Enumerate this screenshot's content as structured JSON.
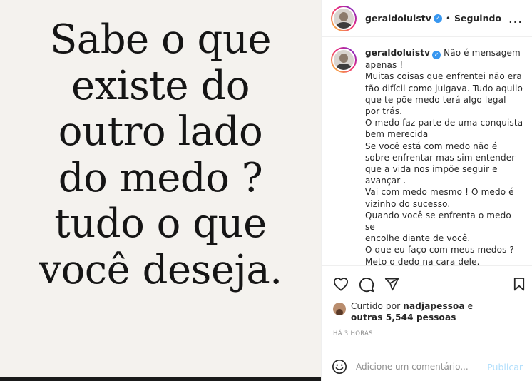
{
  "post_image": {
    "quote_lines": [
      "Sabe o que",
      "existe do",
      "outro lado",
      "do medo ?",
      "tudo o que",
      "você deseja."
    ]
  },
  "header": {
    "username": "geraldoluistv",
    "verified_icon": "verified-badge-icon",
    "separator": "•",
    "follow_status": "Seguindo",
    "more_icon": "..."
  },
  "caption": {
    "username": "geraldoluistv",
    "lines": [
      "Não é mensagem",
      "apenas !",
      "Muitas coisas que enfrentei não era",
      "tão difícil como julgava. Tudo aquilo",
      "que te põe medo terá algo legal",
      "por trás.",
      "O medo faz parte de uma conquista",
      "bem merecida",
      "Se você está com medo não é",
      "sobre enfrentar mas sim entender",
      "que a vida nos impõe seguir e",
      "avançar .",
      "Vai com medo mesmo ! O medo é",
      "vizinho do sucesso.",
      "Quando você se enfrenta o medo se",
      "encolhe diante de você.",
      "O que eu faço com meus medos ?",
      "Meto o dedo na cara dele."
    ]
  },
  "actions": {
    "icons": [
      "heart-icon",
      "comment-icon",
      "share-icon",
      "bookmark-icon"
    ]
  },
  "likes": {
    "prefix": "Curtido por ",
    "user": "nadjapessoa",
    "middle": " e",
    "others": "outras 5,544 pessoas"
  },
  "timestamp": "HÁ 3 HORAS",
  "comment_box": {
    "emoji_icon": "emoji-icon",
    "placeholder": "Adicione um comentário...",
    "publish_label": "Publicar"
  },
  "colors": {
    "verified": "#3897f0",
    "publish_disabled": "#b2dffc",
    "border": "#efefef",
    "muted": "#8e8e8e"
  }
}
